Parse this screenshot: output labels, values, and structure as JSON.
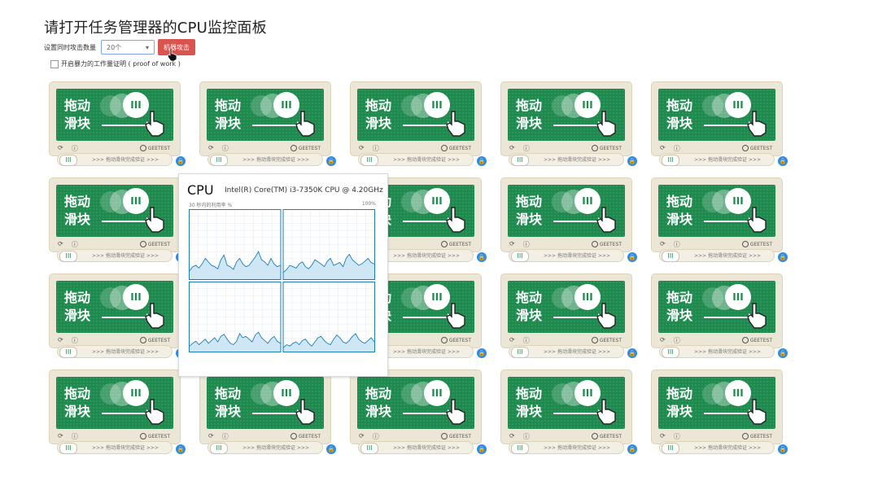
{
  "page": {
    "title": "请打开任务管理器的CPU监控面板",
    "controls": {
      "label": "设置同时攻击数量",
      "select_value": "20个",
      "attack_button": "机器攻击"
    },
    "pow_label": "开启暴力的工作量证明 ( proof of work )"
  },
  "captcha": {
    "panel_text": "拖动\n滑块",
    "knob_glyph": "III",
    "footer_icons": [
      "refresh-icon",
      "info-icon"
    ],
    "brand": "GEETEST",
    "slider_hint": ">>> 拖动滑块完成验证 >>>",
    "lock_glyph": "🔒"
  },
  "cpu_overlay": {
    "title": "CPU",
    "model": "Intel(R) Core(TM) i3-7350K CPU @ 4.20GHz",
    "subtitle": "30 秒内的利用率 %",
    "max_label": "100%",
    "chart_data": {
      "type": "line",
      "title": "CPU",
      "xlabel": "",
      "ylabel": "30 秒内的利用率 %",
      "ylim": [
        0,
        100
      ],
      "grid": true,
      "series": [
        {
          "values": [
            12,
            18,
            20,
            16,
            22,
            30,
            25,
            20,
            18,
            15,
            28,
            35,
            20,
            18,
            14,
            25,
            30,
            22,
            18,
            20,
            26,
            32,
            40,
            28,
            25,
            20,
            30,
            22,
            18,
            20
          ]
        },
        {
          "values": [
            10,
            14,
            20,
            18,
            16,
            22,
            25,
            18,
            15,
            20,
            28,
            25,
            22,
            18,
            26,
            30,
            20,
            22,
            24,
            18,
            30,
            36,
            28,
            24,
            20,
            22,
            26,
            30,
            24,
            22
          ]
        },
        {
          "values": [
            8,
            12,
            15,
            10,
            14,
            18,
            12,
            16,
            20,
            14,
            22,
            25,
            18,
            12,
            10,
            15,
            26,
            20,
            22,
            18,
            14,
            24,
            28,
            20,
            16,
            12,
            18,
            22,
            15,
            12
          ]
        },
        {
          "values": [
            6,
            10,
            8,
            12,
            14,
            10,
            16,
            18,
            12,
            8,
            14,
            20,
            22,
            16,
            12,
            10,
            18,
            24,
            20,
            14,
            12,
            16,
            22,
            26,
            18,
            14,
            12,
            16,
            20,
            14
          ]
        }
      ]
    }
  }
}
